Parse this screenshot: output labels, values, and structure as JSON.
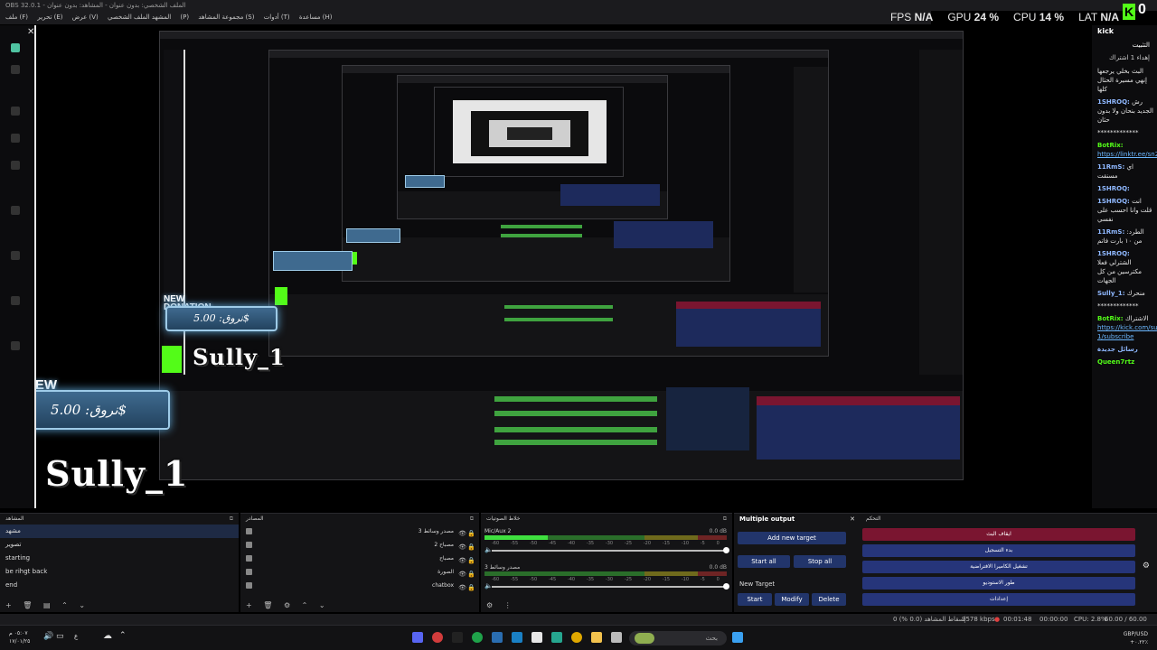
{
  "window": {
    "title": "OBS 32.0.1 - الملف الشخصي: بدون عنوان - المشاهد: بدون عنوان"
  },
  "menu": [
    "ملف (F)",
    "تحرير (E)",
    "عرض (V)",
    "المشهد",
    "الملف الشخصي (P)",
    "مجموعة المشاهد (S)",
    "أدوات (T)",
    "مساعدة (H)"
  ],
  "stats": {
    "fps_label": "FPS",
    "fps_value": "N/A",
    "gpu_label": "GPU",
    "gpu_value": "24 %",
    "cpu_label": "CPU",
    "cpu_value": "14 %",
    "lat_label": "LAT",
    "lat_value": "N/A"
  },
  "kick_badge": {
    "logo_letter": "K",
    "count": "0"
  },
  "overlay": {
    "donation_title_line1": "NEW",
    "donation_title_line2": "DONATION",
    "donation_amount": "نروق: 5.00$",
    "streamer_name": "Sully_1"
  },
  "chat": {
    "header": "kick",
    "pinned_title": "التثبيت",
    "pinned_text": "إهداء 1 اشتراك",
    "messages": [
      {
        "user": "",
        "text": "البث بخلي يرجعها إنهي مسيرة الحثال كلها",
        "link": ""
      },
      {
        "user": "1SHROQ:",
        "text": "رش الجديد بنحان ولا بدون حثان",
        "link": ""
      },
      {
        "user": "",
        "text": "*************",
        "link": ""
      },
      {
        "user": "BotRix:",
        "text": "",
        "link": "https://linktr.ee/sn2.s"
      },
      {
        "user": "11RmS:",
        "text": "اي مسنقت",
        "link": ""
      },
      {
        "user": "1SHROQ:",
        "text": "",
        "link": ""
      },
      {
        "user": "1SHROQ:",
        "text": "انت قلت وانا احسب على نفسي",
        "link": ""
      },
      {
        "user": "11RmS:",
        "text": "الطرد: من ١٠ بارت فاتم",
        "link": ""
      },
      {
        "user": "1SHROQ:",
        "text": "الشترلي فعلا مكترسين من كل الجهات",
        "link": ""
      },
      {
        "user": "Sully_1:",
        "text": "منحرك",
        "link": ""
      },
      {
        "user": "",
        "text": "*************",
        "link": ""
      },
      {
        "user": "BotRix:",
        "text": "الاشتراك",
        "link": "https://kick.com/sully-1/subscribe"
      },
      {
        "user": "رسائل جديدة",
        "text": "",
        "link": ""
      },
      {
        "user": "Queen7rtz",
        "text": "",
        "link": ""
      }
    ]
  },
  "docks": {
    "scenes": {
      "title": "المشاهد",
      "items": [
        "مشهد",
        "تصوير",
        "starting",
        "be rihgt back",
        "end"
      ],
      "selected_index": 0
    },
    "sources": {
      "title": "المصادر",
      "items": [
        "مصدر وسائط 3",
        "مصباح 2",
        "مصباح",
        "الصورة",
        "chatbox"
      ]
    },
    "mixer": {
      "title": "خلاط الصوتيات",
      "tracks": [
        {
          "name": "Mic/Aux 2",
          "db": "0.0 dB",
          "level": 0.26
        },
        {
          "name": "مصدر وسائط 3",
          "db": "0.0 dB",
          "level": 0.0
        }
      ],
      "ticks": [
        "-60",
        "-55",
        "-50",
        "-45",
        "-40",
        "-35",
        "-30",
        "-25",
        "-20",
        "-15",
        "-10",
        "-5",
        "0"
      ]
    },
    "multiple_output": {
      "title": "Multiple output",
      "add_target": "Add new target",
      "start_all": "Start all",
      "stop_all": "Stop all",
      "new_target": "New Target",
      "start": "Start",
      "modify": "Modify",
      "delete": "Delete"
    },
    "controls": {
      "title": "التحكم",
      "buttons": [
        "ايقاف البث",
        "بدء التسجيل",
        "تشغيل الكاميرا الافتراضية",
        "طور الاستوديو",
        "إعدادات"
      ]
    }
  },
  "statusbar": {
    "dropped": "إسقاط المشاهد (0.0 %) 0",
    "bitrate": "9578 kbps",
    "live_time": "00:01:48",
    "rec_time": "00:00:00",
    "cpu": "CPU: 2.8%",
    "fps": "60.00 / 60.00 FPS"
  },
  "taskbar": {
    "search_placeholder": "بحث",
    "clock_time": "٠٥:٠٧ م",
    "clock_date": "١٧/٠١/٢٥",
    "lang": "ع",
    "currency_pair": "GBP/USD",
    "currency_change": "+٠.٢٢٪"
  },
  "colors": {
    "accent_blue": "#22356b",
    "stop_red": "#7a1530",
    "kick_green": "#53fc18",
    "meter_green": "#3fe03f"
  }
}
